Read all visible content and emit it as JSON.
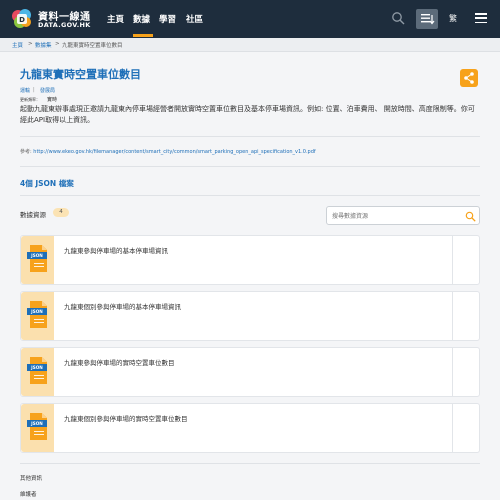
{
  "brand": {
    "name_cn": "資料一線通",
    "name_en": "DATA.GOV.HK"
  },
  "nav": {
    "items": [
      "主頁",
      "數據",
      "學習",
      "社區"
    ],
    "lang": "繁"
  },
  "breadcrumb": {
    "items": [
      "主頁",
      ">",
      "數據集",
      ">",
      "九龍東實時空置車位數目"
    ]
  },
  "dataset": {
    "title": "九龍東實時空置車位數目",
    "meta_links": [
      "運輸",
      "|",
      "發展局"
    ],
    "update_label": "更新頻率：",
    "update_value": "實時",
    "description": "起動九龍東辦事處現正邀請九龍東內停車場經營者開放實時空置車位數目及基本停車場資訊。例如: 位置、泊車費用、 開放時間、高度限制等。你可經此API取得以上資訊。",
    "reference_label": "參考:",
    "reference_url": "http://www.ekeo.gov.hk/filemanager/content/smart_city/common/smart_parking_open_api_specification_v1.0.pdf"
  },
  "resources": {
    "json_count": "4個 JSON 檔案",
    "label": "數據資源",
    "count": "4",
    "search_placeholder": "搜尋數據資源",
    "file_tag": "JSON",
    "items": [
      {
        "title": "九龍東參與停車場的基本停車場資訊"
      },
      {
        "title": "九龍東個別參與停車場的基本停車場資訊"
      },
      {
        "title": "九龍東參與停車場的實時空置車位數目"
      },
      {
        "title": "九龍東個別參與停車場的實時空置車位數目"
      }
    ]
  },
  "footer": {
    "other_info": "其他資訊",
    "contact": "維護者"
  },
  "colors": {
    "header_bg": "#1e2d3d",
    "accent": "#f7a21b",
    "link": "#1e6fb8"
  }
}
